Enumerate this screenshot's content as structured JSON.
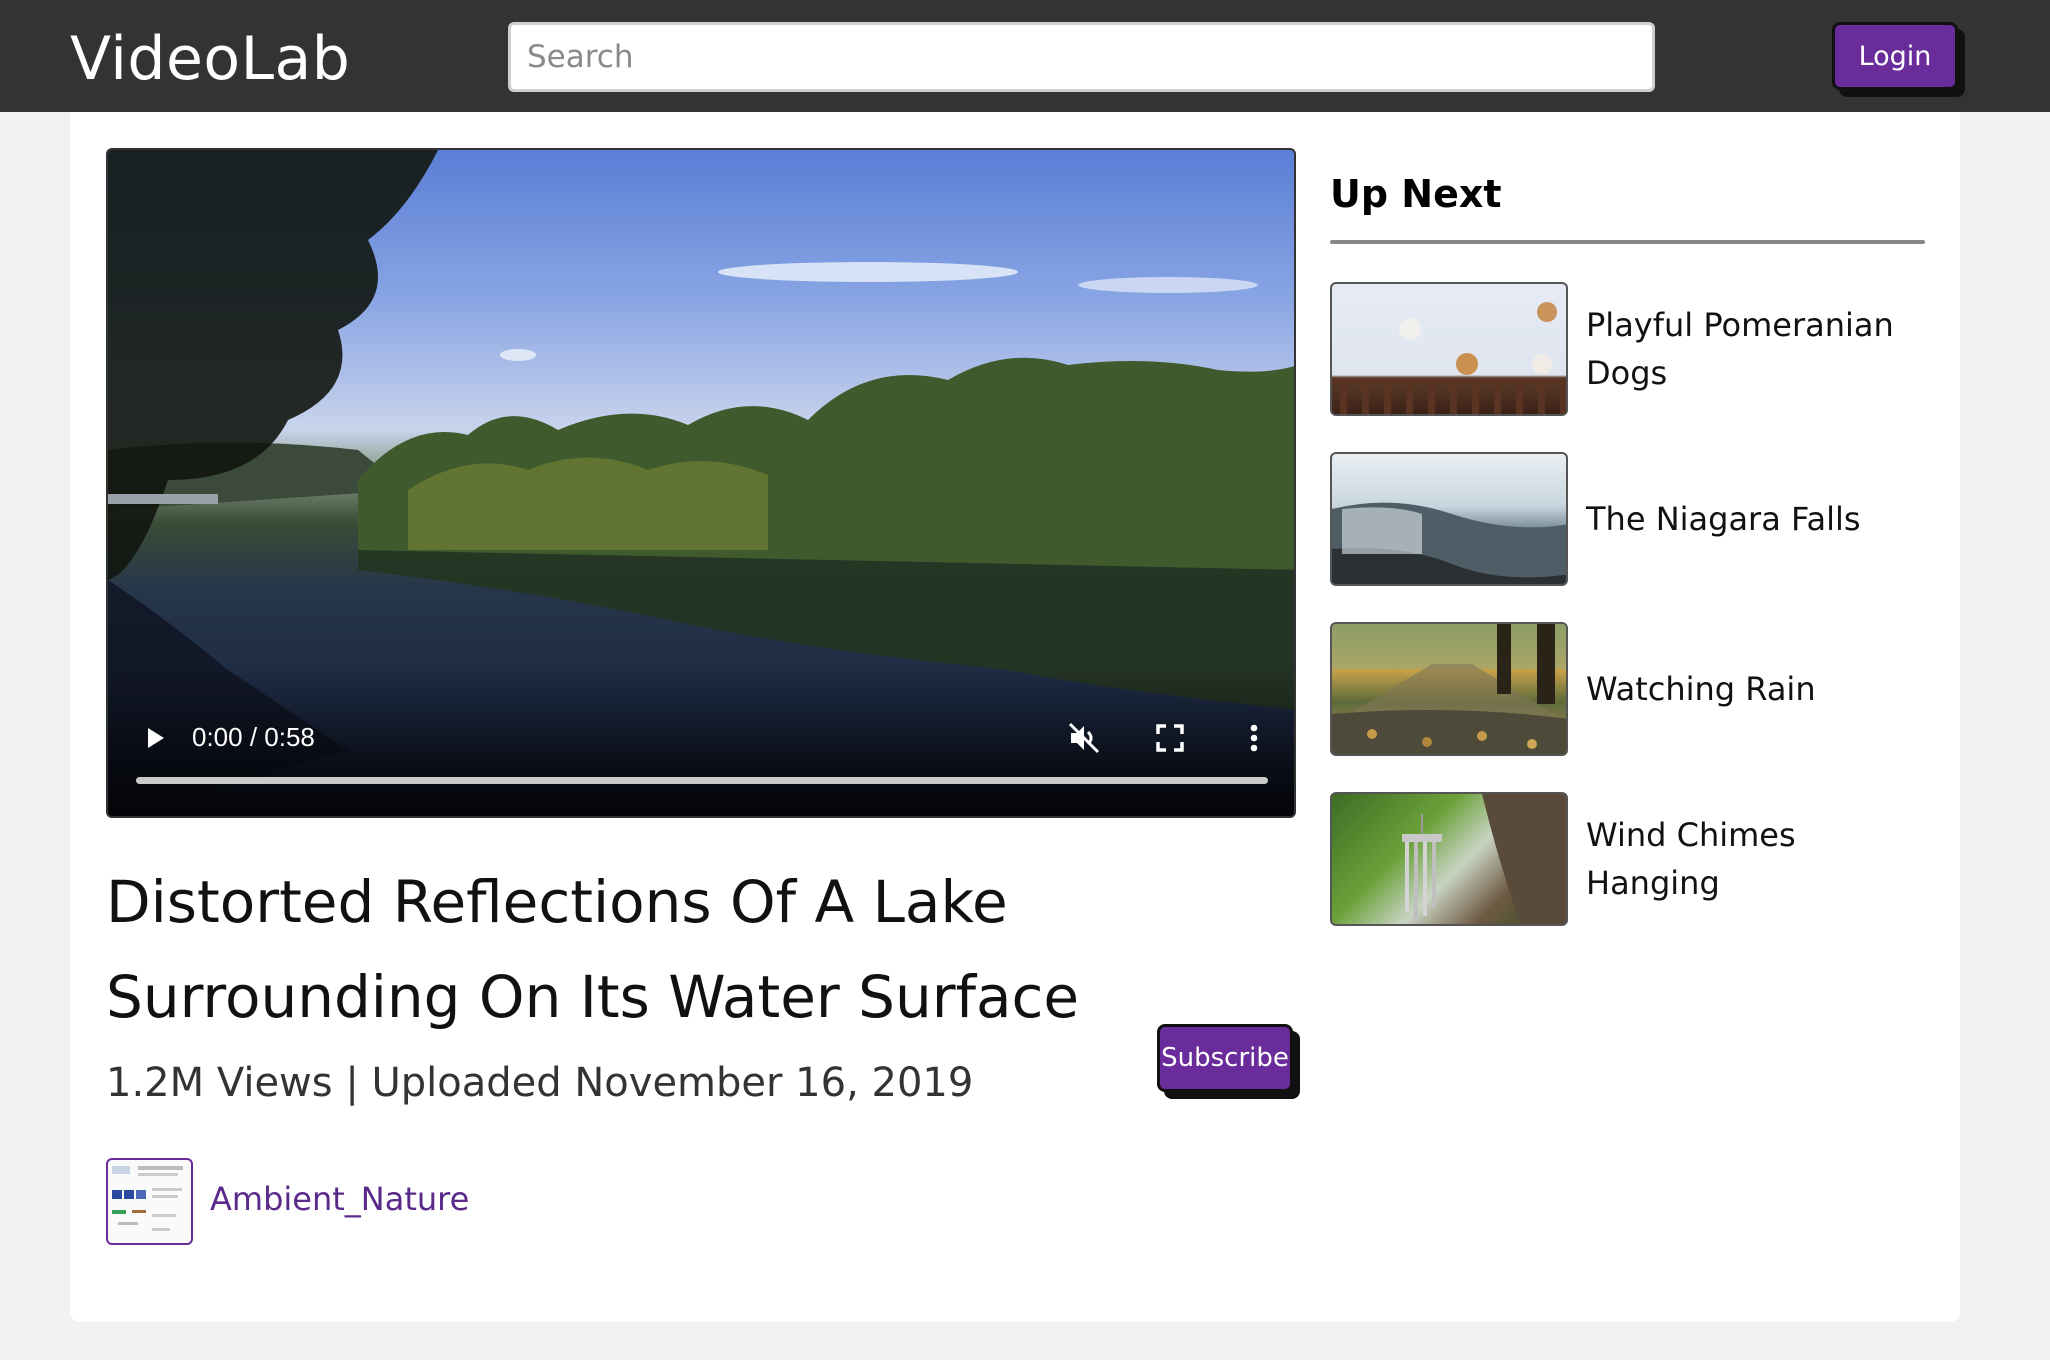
{
  "header": {
    "logo": "VideoLab",
    "search_placeholder": "Search",
    "login_label": "Login"
  },
  "player": {
    "time_display": "0:00 / 0:58",
    "progress": 0,
    "muted": true
  },
  "video": {
    "title": "Distorted Reflections Of A Lake Surrounding On Its Water Surface",
    "meta": "1.2M Views | Uploaded November 16, 2019",
    "subscribe_label": "Subscribe",
    "channel": "Ambient_Nature"
  },
  "up_next": {
    "heading": "Up Next",
    "items": [
      {
        "title": "Playful Pomeranian Dogs"
      },
      {
        "title": "The Niagara Falls"
      },
      {
        "title": "Watching Rain"
      },
      {
        "title": "Wind Chimes Hanging"
      }
    ]
  },
  "colors": {
    "header_bg": "#333333",
    "accent": "#6a2c9a",
    "channel_link": "#5a2a8a"
  }
}
